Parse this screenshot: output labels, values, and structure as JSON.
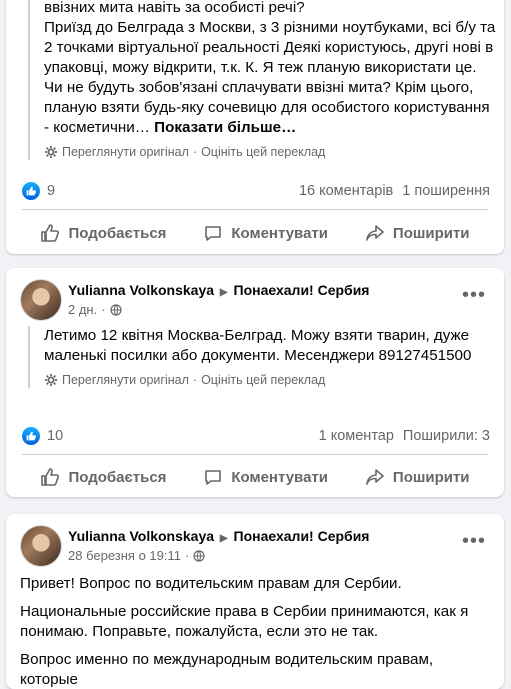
{
  "post1": {
    "text_lines": [
      "ввізних мита навіть за особисті речі?",
      "Приїзд до Белграда з Москви, з 3 різними ноутбуками, всі б/у та 2 точками віртуальної реальності Деякі користуюсь, другі нові в упаковці, можу відкрити, т.к. К. Я теж планую використати це.",
      "Чи не будуть зобов'язані сплачувати ввізні мита? Крім цього, планую взяти будь-яку сочевицю для особистого користування - косметични…"
    ],
    "more_label": "Показати більше…",
    "see_original": "Переглянути оригінал",
    "rate_translation": "Оцініть цей переклад",
    "likes": "9",
    "comments": "16 коментарів",
    "shares": "1 поширення"
  },
  "post2": {
    "author": "Yulianna Volkonskaya",
    "group": "Понаехали! Сербия",
    "time": "2 дн.",
    "text": "Летимо 12 квітня Москва-Белград. Можу взяти тварин, дуже маленькі посилки або документи. Месенджери 89127451500",
    "see_original": "Переглянути оригінал",
    "rate_translation": "Оцініть цей переклад",
    "likes": "10",
    "comments": "1 коментар",
    "shares": "Поширили: 3"
  },
  "post3": {
    "author": "Yulianna Volkonskaya",
    "group": "Понаехали! Сербия",
    "time": "28 березня о 19:11",
    "paragraphs": [
      "Привет! Вопрос по водительским правам для Сербии.",
      "Национальные российские права в Сербии принимаются, как я понимаю. Поправьте, пожалуйста, если это не так.",
      "Вопрос именно по международным водительским правам, которые"
    ]
  },
  "actions": {
    "like": "Подобається",
    "comment": "Коментувати",
    "share": "Поширити"
  },
  "separator": "·",
  "colors": {
    "accent": "#1877f2",
    "muted": "#65676b",
    "background": "#f0f2f5"
  }
}
